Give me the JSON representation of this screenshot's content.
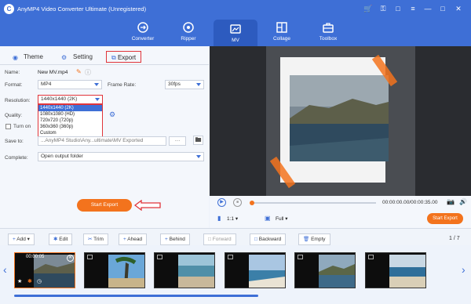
{
  "app": {
    "title": "AnyMP4 Video Converter Ultimate (Unregistered)"
  },
  "nav": [
    {
      "label": "Converter",
      "icon": "converter-icon"
    },
    {
      "label": "Ripper",
      "icon": "ripper-icon"
    },
    {
      "label": "MV",
      "icon": "mv-icon"
    },
    {
      "label": "Collage",
      "icon": "collage-icon"
    },
    {
      "label": "Toolbox",
      "icon": "toolbox-icon"
    }
  ],
  "tabs": {
    "theme": "Theme",
    "setting": "Setting",
    "export": "Export"
  },
  "form": {
    "name_label": "Name:",
    "name_value": "New MV.mp4",
    "format_label": "Format:",
    "format_value": "MP4",
    "framerate_label": "Frame Rate:",
    "framerate_value": "30fps",
    "resolution_label": "Resolution:",
    "resolution_value": "1440x1440 (2K)",
    "resolution_options": [
      "1440x1440 (2K)",
      "1080x1080 (HD)",
      "720x720 (720p)",
      "360x360 (360p)",
      "Custom"
    ],
    "quality_label": "Quality:",
    "turn_on_label": "Turn on",
    "saveto_label": "Save to:",
    "saveto_value": "...AnyMP4 Studio\\Any...ultimate\\MV Exported",
    "saveto_dots": "···",
    "complete_label": "Complete:",
    "complete_value": "Open output folder"
  },
  "start_export": "Start Export",
  "player": {
    "time": "00:00:00.00/00:00:35.00",
    "ratio": "1:1",
    "mode": "Full",
    "start_export": "Start Export"
  },
  "toolbar": {
    "add": "Add",
    "edit": "Edit",
    "trim": "Trim",
    "ahead": "Ahead",
    "behind": "Behind",
    "forward": "Forward",
    "backward": "Backward",
    "empty": "Empty",
    "page": "1 / 7"
  },
  "timeline": {
    "first_time": "00:00:05"
  },
  "colors": {
    "brand": "#3e6fd6",
    "accent": "#f3731d",
    "highlight": "#e0343a"
  }
}
